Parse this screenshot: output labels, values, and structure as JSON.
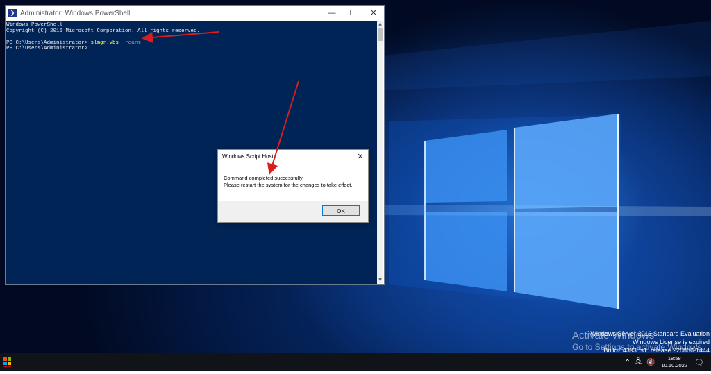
{
  "powershell": {
    "title": "Administrator: Windows PowerShell",
    "lines": [
      "Windows PowerShell",
      "Copyright (C) 2016 Microsoft Corporation. All rights reserved."
    ],
    "prompt1": "PS C:\\Users\\Administrator> ",
    "command": "slmgr.vbs",
    "argument": "-rearm",
    "prompt2": "PS C:\\Users\\Administrator>"
  },
  "dialog": {
    "title": "Windows Script Host",
    "message_line1": "Command completed successfully.",
    "message_line2": "Please restart the system for the changes to take effect.",
    "ok_label": "OK"
  },
  "watermark": {
    "line1": "Activate Windows",
    "line2": "Go to Settings to activate Windows."
  },
  "build_info": {
    "line1": "Windows Server 2016 Standard Evaluation",
    "line2": "Windows License is expired",
    "line3": "Build 14393.rs1_release.220806-1444"
  },
  "taskbar": {
    "time": "18:58",
    "date": "10.10.2022"
  },
  "icons": [
    "powershell-icon",
    "minimize-icon",
    "maximize-icon",
    "close-icon",
    "start-icon",
    "network-icon",
    "volume-icon",
    "notification-icon"
  ],
  "colors": {
    "console_bg": "#012456",
    "command": "#fcfc54",
    "accent": "#0078d7",
    "annotation_arrow": "#d81e1e"
  }
}
